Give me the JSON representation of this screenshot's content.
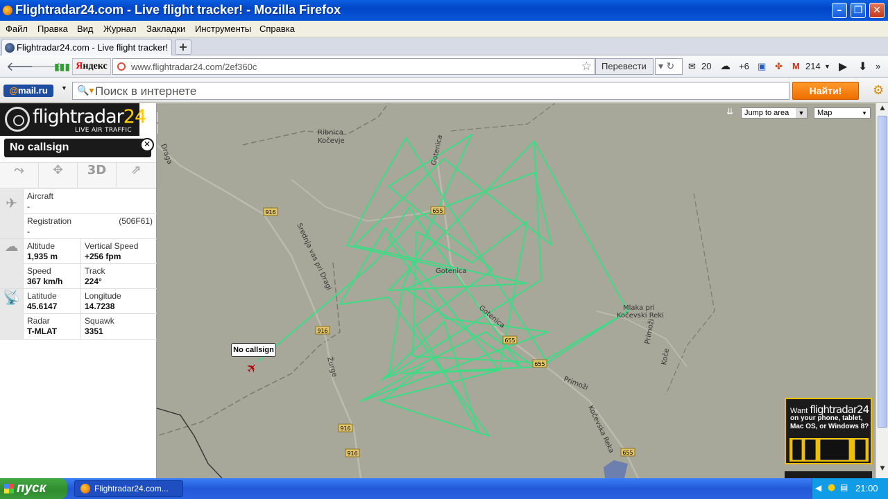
{
  "window": {
    "title": "Flightradar24.com - Live flight tracker! - Mozilla Firefox"
  },
  "menu": [
    "Файл",
    "Правка",
    "Вид",
    "Журнал",
    "Закладки",
    "Инструменты",
    "Справка"
  ],
  "tab": {
    "label": "Flightradar24.com - Live flight tracker!",
    "new_tab": "+"
  },
  "nav": {
    "yandex_prefix": "Я",
    "yandex_rest": "ндекс",
    "url": "www.flightradar24.com/2ef360c",
    "translate": "Перевести",
    "mail_count": "20",
    "weather": "+6",
    "gmail_count": "214"
  },
  "search": {
    "mailru_prefix": "@",
    "mailru_rest": "mail.ru",
    "placeholder": "Поиск в интернете",
    "button": "Найти!"
  },
  "app": {
    "logo_a": "flightradar",
    "logo_b": "24",
    "logo_sub": "LIVE AIR TRAFFIC",
    "callsign": "No callsign",
    "tool_3d": "3D",
    "aircraft_label": "Aircraft",
    "aircraft_value": "-",
    "registration_label": "Registration",
    "registration_value": "-",
    "registration_code": "(506F61)",
    "altitude_label": "Altitude",
    "altitude_value": "1,935 m",
    "vspeed_label": "Vertical Speed",
    "vspeed_value": "+256 fpm",
    "speed_label": "Speed",
    "speed_value": "367 km/h",
    "track_label": "Track",
    "track_value": "224°",
    "lat_label": "Latitude",
    "lat_value": "45.6147",
    "lon_label": "Longitude",
    "lon_value": "14.7238",
    "radar_label": "Radar",
    "radar_value": "T-MLAT",
    "squawk_label": "Squawk",
    "squawk_value": "3351",
    "jump": "Jump to area",
    "maptype": "Map",
    "zoom_in": "+",
    "zoom_out": "−",
    "tooltip": "No callsign",
    "promo_want": "Want ",
    "promo_brand": "flightradar24",
    "promo_text": "on your phone, tablet, Mac OS, or Windows 8?"
  },
  "map_labels": {
    "ribnica": "Ribnica",
    "kocevje": "Kočevje",
    "draga": "Draga",
    "gotenica": "Gotenica",
    "gotenica_c": "Gotenica",
    "gotenica_r": "Gotenica",
    "sredina": "Srednja vas pri Dragi",
    "mlaka": "Mlaka pri",
    "kocevski_reki": "Kočevski Reki",
    "primozi": "Primoži",
    "kocevska_reka": "Kočevska Reka",
    "koce": "Koče",
    "zurge": "Žurge",
    "primozi2": "Primoži",
    "r916a": "916",
    "r916b": "916",
    "r916c": "916",
    "r916d": "916",
    "r655a": "655",
    "r655b": "655",
    "r655c": "655",
    "r655d": "655"
  },
  "taskbar": {
    "start": "пуск",
    "task": "Flightradar24.com...",
    "clock": "21:00"
  },
  "colors": {
    "track": "#3ddc84",
    "map_bg": "#a7a79a",
    "accent": "#ee6d00"
  }
}
